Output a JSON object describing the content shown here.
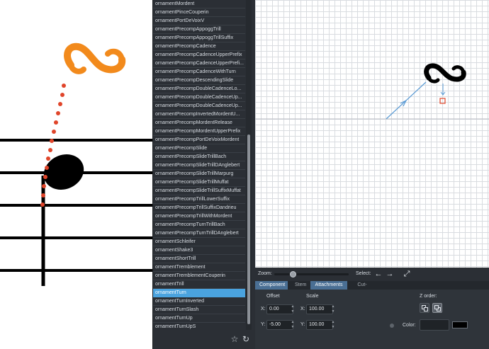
{
  "colors": {
    "accent_orange": "#f28a1c",
    "dots_red": "#e0452a",
    "selected_blue": "#4aa3df",
    "panel_dark": "#2b2f35"
  },
  "glyph_list": {
    "items": [
      "ornamentMordent",
      "ornamentPinceCouperin",
      "ornamentPortDeVoixV",
      "ornamentPrecompAppoggTrill",
      "ornamentPrecompAppoggTrillSuffix",
      "ornamentPrecompCadence",
      "ornamentPrecompCadenceUpperPrefix",
      "ornamentPrecompCadenceUpperPrefi...",
      "ornamentPrecompCadenceWithTurn",
      "ornamentPrecompDescendingSlide",
      "ornamentPrecompDoubleCadenceLo...",
      "ornamentPrecompDoubleCadenceUp...",
      "ornamentPrecompDoubleCadenceUp...",
      "ornamentPrecompInvertedMordentU...",
      "ornamentPrecompMordentRelease",
      "ornamentPrecompMordentUpperPrefix",
      "ornamentPrecompPortDeVoixMordent",
      "ornamentPrecompSlide",
      "ornamentPrecompSlideTrillBach",
      "ornamentPrecompSlideTrillDAnglebert",
      "ornamentPrecompSlideTrillMarpurg",
      "ornamentPrecompSlideTrillMuffat",
      "ornamentPrecompSlideTrillSuffixMuffat",
      "ornamentPrecompTrillLowerSuffix",
      "ornamentPrecompTrillSuffixDandrieu",
      "ornamentPrecompTrillWithMordent",
      "ornamentPrecompTurnTrillBach",
      "ornamentPrecompTurnTrillDAnglebert",
      "ornamentSchleifer",
      "ornamentShake3",
      "ornamentShortTrill",
      "ornamentTremblement",
      "ornamentTremblementCouperin",
      "ornamentTrill",
      "ornamentTurn",
      "ornamentTurnInverted",
      "ornamentTurnSlash",
      "ornamentTurnUp",
      "ornamentTurnUpS"
    ],
    "selected_index": 34,
    "footer": {
      "favorite_icon": "star-icon",
      "reset_icon": "reset-icon"
    }
  },
  "toolbar": {
    "zoom_label": "Zoom:",
    "zoom_level": 0.23,
    "select_label": "Select:",
    "left_arrow": "←",
    "right_arrow": "→",
    "diagonal_arrow": "⤢"
  },
  "tabs": [
    {
      "label": "Component",
      "active": true
    },
    {
      "label": "Stem",
      "active": false
    },
    {
      "label": "Attachments",
      "active": true
    },
    {
      "label": "Cut-outs",
      "active": false
    }
  ],
  "component": {
    "offset_label": "Offset",
    "scale_label": "Scale",
    "x_label": "X:",
    "y_label": "Y:",
    "offset_x": "0.00",
    "offset_y": "-5.00",
    "scale_x": "100.00",
    "scale_y": "100.00",
    "zorder_label": "Z order:",
    "color_label": "Color:",
    "color_value": "#000000"
  }
}
